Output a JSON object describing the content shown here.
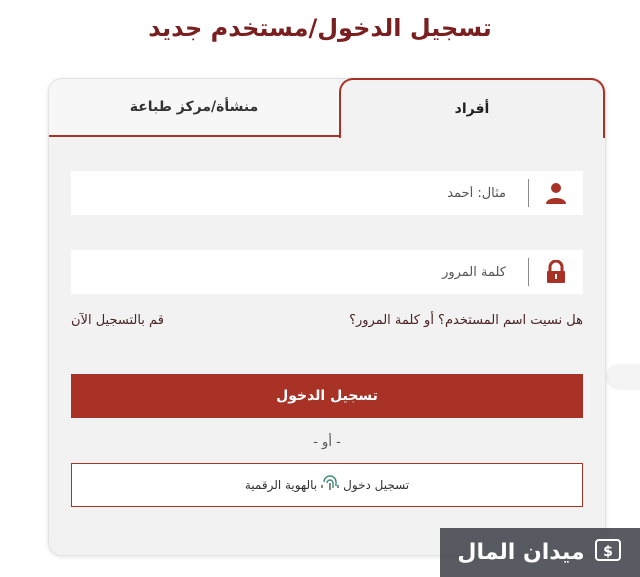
{
  "page": {
    "title": "تسجيل الدخول/مستخدم جديد"
  },
  "tabs": {
    "individuals": "أفراد",
    "organization": "منشأة/مركز طباعة"
  },
  "username": {
    "placeholder": "مثال: أحمد",
    "icon": "user-icon"
  },
  "password": {
    "placeholder": "كلمة المرور",
    "icon": "lock-icon"
  },
  "links": {
    "forgot": "هل نسيت اسم المستخدم؟ أو كلمة المرور؟",
    "register": "قم بالتسجيل الآن"
  },
  "login_button": "تسجيل الدخول",
  "or_separator": "-  أو  -",
  "digital_id": {
    "label_before": "تسجيل دخول",
    "label_after": "بالهوية الرقمية",
    "icon": "fingerprint-icon"
  },
  "watermark": {
    "text": "ميدان المال",
    "icon": "money-icon"
  },
  "colors": {
    "accent": "#a93227",
    "title": "#7a1f1f",
    "card_bg": "#f2f2f2"
  }
}
